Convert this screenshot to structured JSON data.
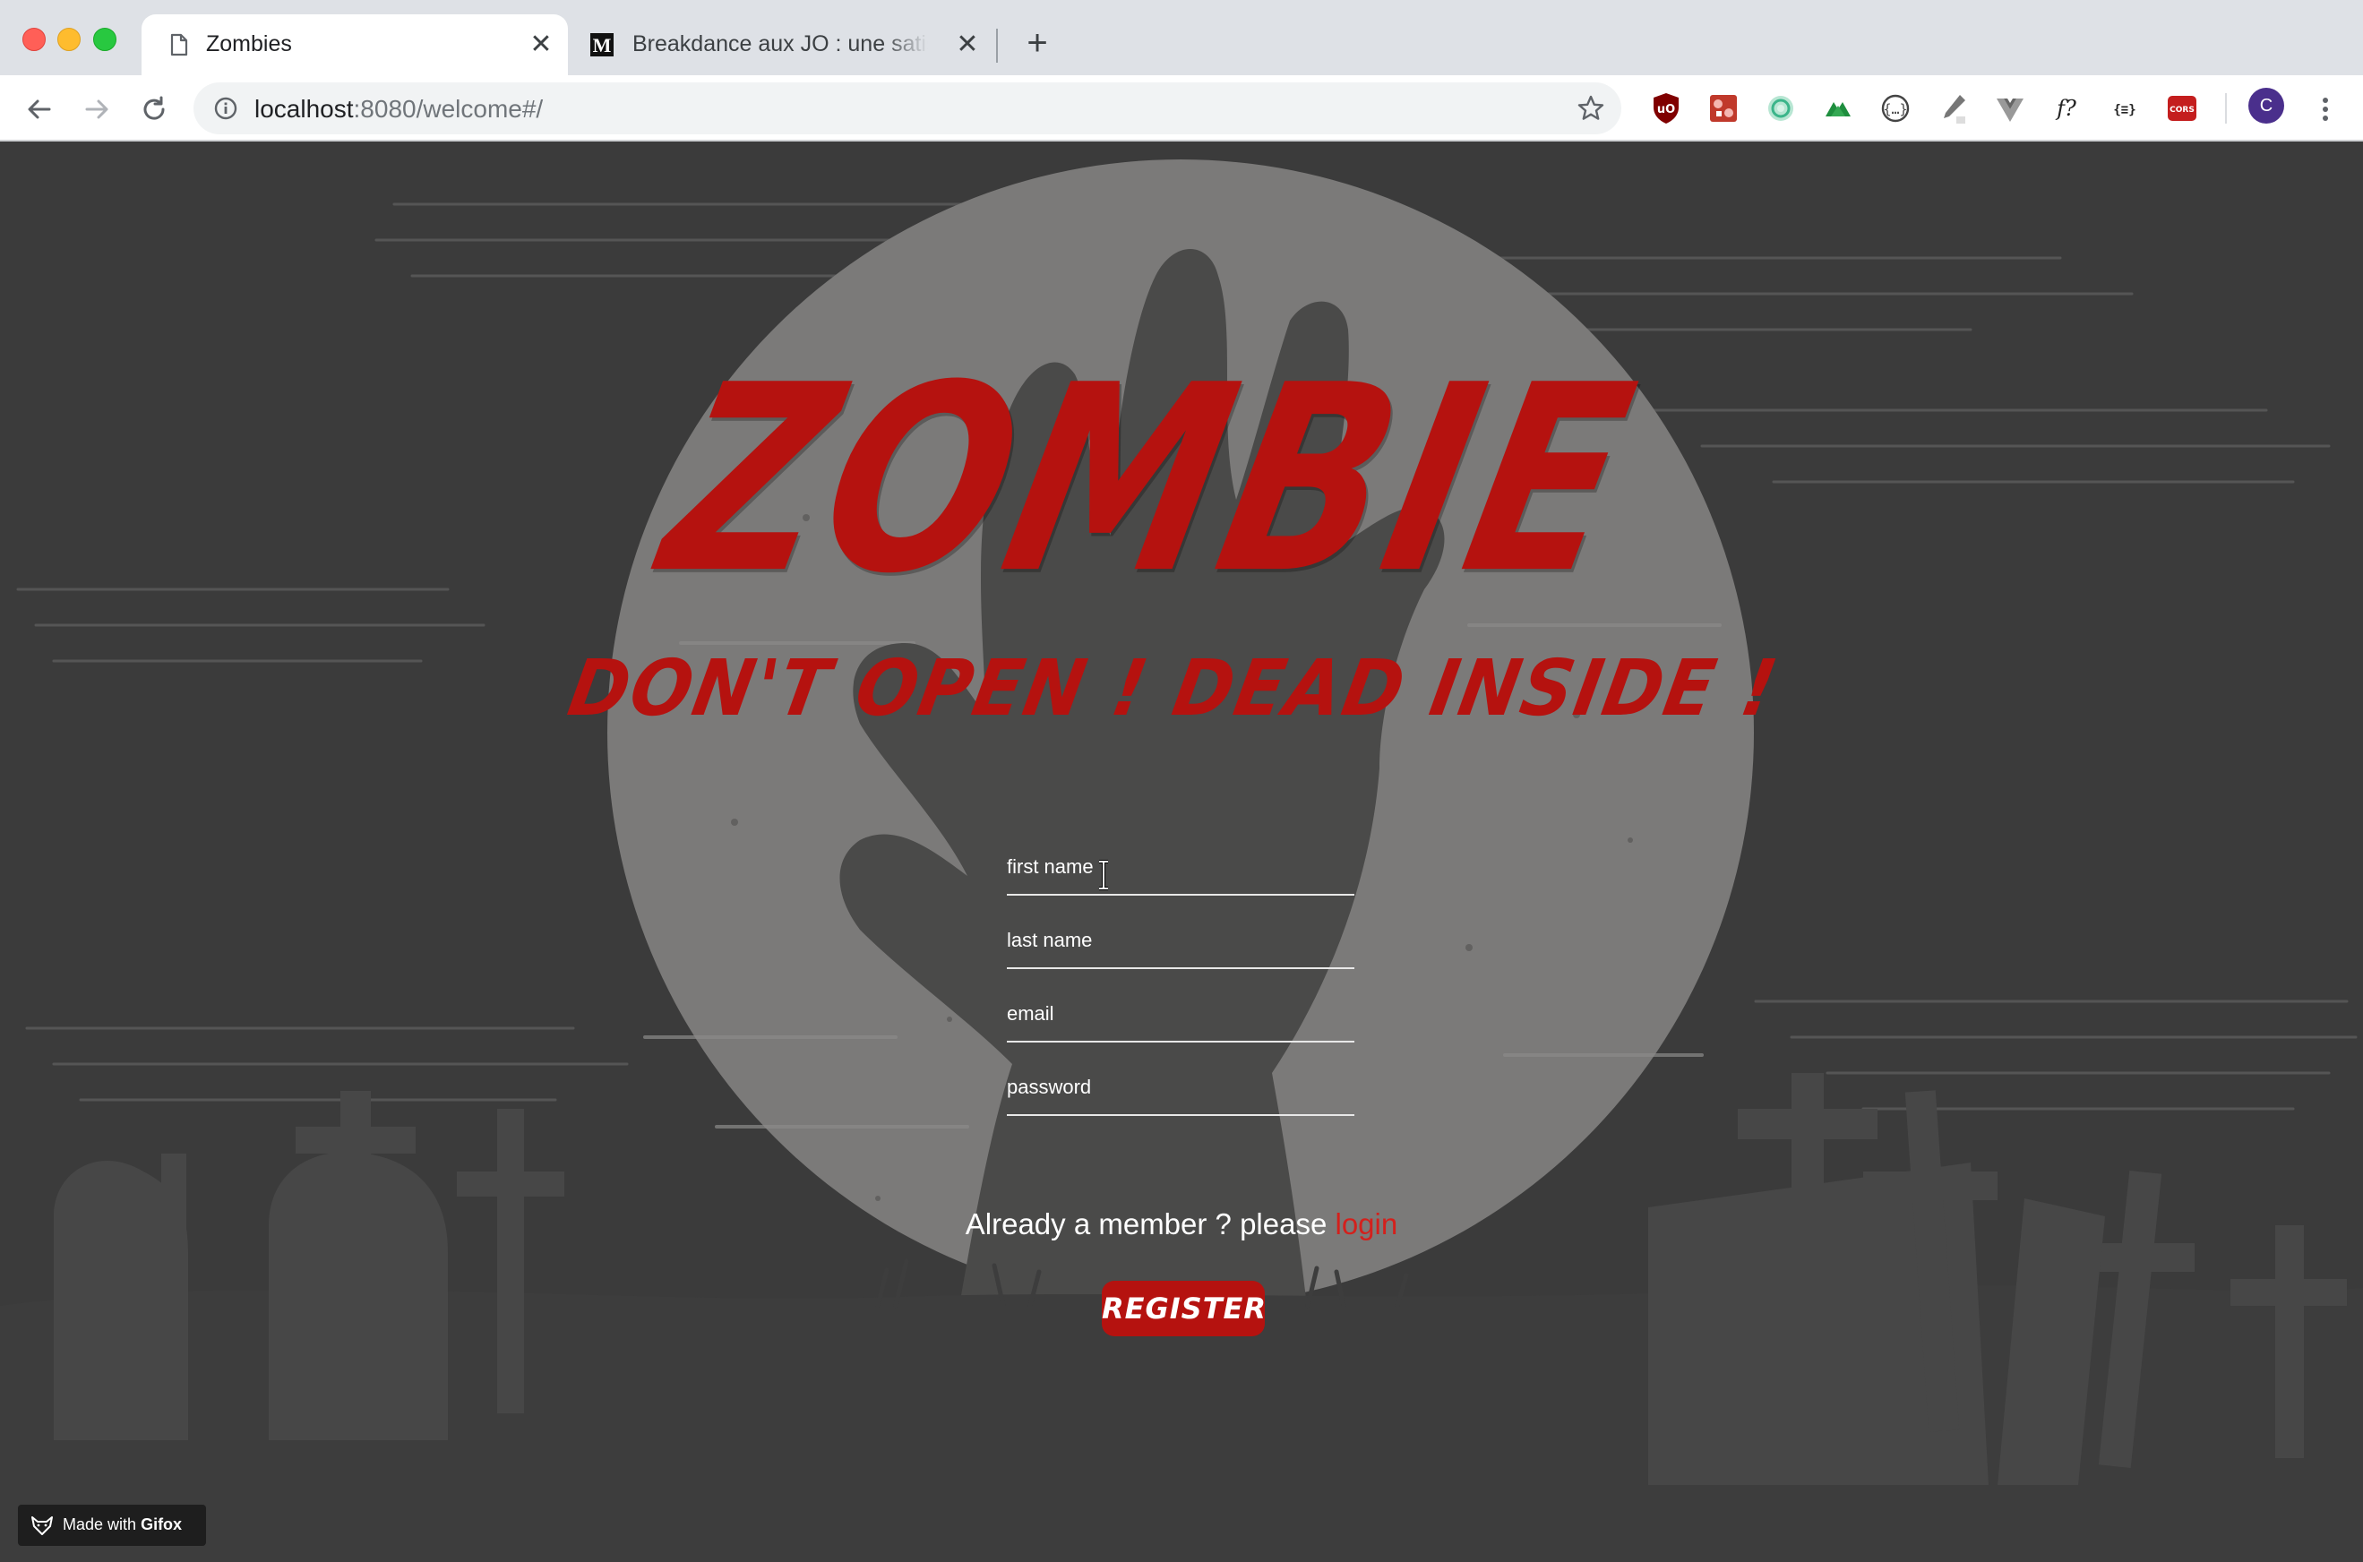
{
  "browser": {
    "tabs": [
      {
        "title": "Zombies",
        "active": true,
        "favicon": "document-icon"
      },
      {
        "title": "Breakdance aux JO : une satisfaction",
        "active": false,
        "favicon": "le-monde-icon"
      }
    ],
    "new_tab_label": "+",
    "close_glyph": "✕",
    "url_host": "localhost",
    "url_path": ":8080/welcome#/",
    "profile_initial": "C",
    "extensions": [
      "ublock-icon",
      "puzzle-icon",
      "colorzilla-icon",
      "vue-devtools-icon",
      "json-icon",
      "eyedropper-icon",
      "vuejs-icon",
      "font-icon",
      "json-viewer-icon",
      "cors-icon"
    ]
  },
  "page": {
    "title": "ZOMBIE",
    "subtitle": "DON'T OPEN ! DEAD INSIDE !",
    "form": {
      "first_name_placeholder": "first name",
      "last_name_placeholder": "last name",
      "email_placeholder": "email",
      "password_placeholder": "password",
      "register_label": "REGISTER"
    },
    "footer": {
      "already_text": "Already a member ? please",
      "login_link": "login"
    },
    "badge": {
      "made_with": "Made with",
      "brand": "Gifox"
    }
  },
  "colors": {
    "accent_red": "#b5120f",
    "background": "#3b3b3b",
    "moon": "#7a7978"
  }
}
